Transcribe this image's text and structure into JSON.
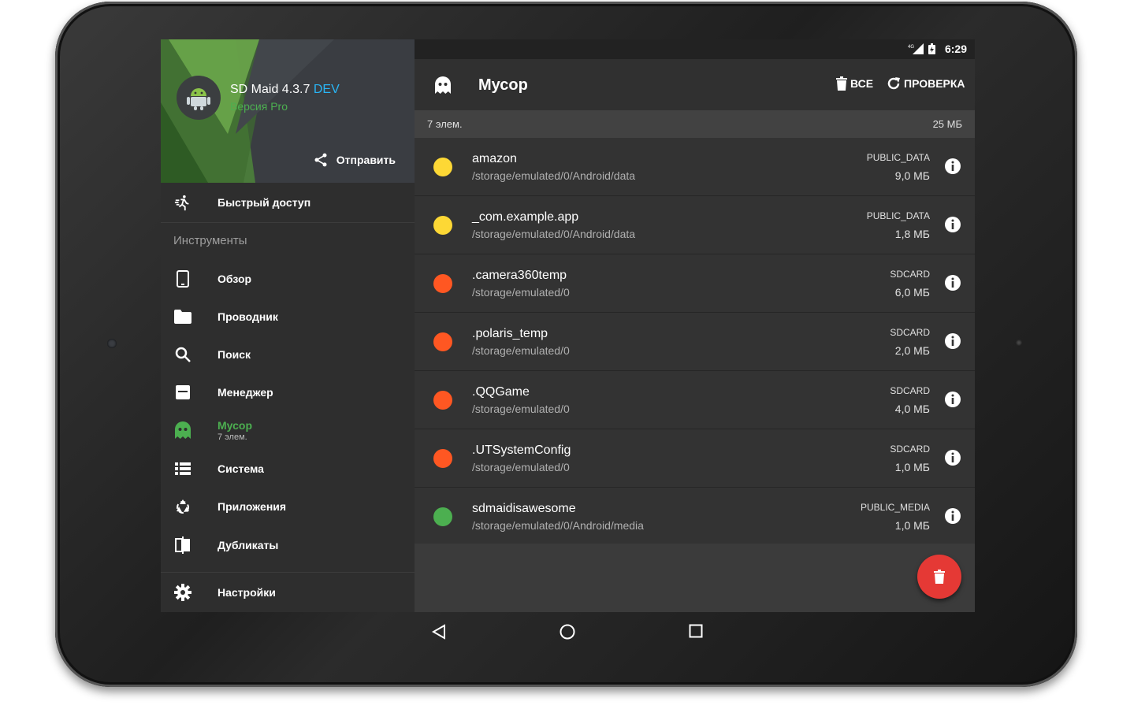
{
  "status": {
    "time": "6:29",
    "network": "4G"
  },
  "drawer": {
    "app_name": "SD Maid 4.3.7",
    "app_tag": "DEV",
    "app_edition": "Версия Pro",
    "share_label": "Отправить",
    "quick_access": "Быстрый доступ",
    "section_tools": "Инструменты",
    "items": [
      {
        "label": "Обзор",
        "icon": "phone-icon"
      },
      {
        "label": "Проводник",
        "icon": "folder-icon"
      },
      {
        "label": "Поиск",
        "icon": "search-icon"
      },
      {
        "label": "Менеджер",
        "icon": "app-manager-icon"
      },
      {
        "label": "Мусор",
        "sub": "7 элем.",
        "icon": "ghost-icon",
        "active": true
      },
      {
        "label": "Система",
        "icon": "list-icon"
      },
      {
        "label": "Приложения",
        "icon": "recycle-icon"
      },
      {
        "label": "Дубликаты",
        "icon": "duplicates-icon"
      }
    ],
    "settings": "Настройки"
  },
  "toolbar": {
    "title": "Мусор",
    "all_label": "ВСЕ",
    "check_label": "ПРОВЕРКА"
  },
  "summary": {
    "count": "7 элем.",
    "size": "25 МБ"
  },
  "entries": [
    {
      "name": "amazon",
      "path": "/storage/emulated/0/Android/data",
      "location": "PUBLIC_DATA",
      "size": "9,0 МБ",
      "color": "#fdd835"
    },
    {
      "name": "_com.example.app",
      "path": "/storage/emulated/0/Android/data",
      "location": "PUBLIC_DATA",
      "size": "1,8 МБ",
      "color": "#fdd835"
    },
    {
      "name": ".camera360temp",
      "path": "/storage/emulated/0",
      "location": "SDCARD",
      "size": "6,0 МБ",
      "color": "#ff5722"
    },
    {
      "name": ".polaris_temp",
      "path": "/storage/emulated/0",
      "location": "SDCARD",
      "size": "2,0 МБ",
      "color": "#ff5722"
    },
    {
      "name": ".QQGame",
      "path": "/storage/emulated/0",
      "location": "SDCARD",
      "size": "4,0 МБ",
      "color": "#ff5722"
    },
    {
      "name": ".UTSystemConfig",
      "path": "/storage/emulated/0",
      "location": "SDCARD",
      "size": "1,0 МБ",
      "color": "#ff5722"
    },
    {
      "name": "sdmaidisawesome",
      "path": "/storage/emulated/0/Android/media",
      "location": "PUBLIC_MEDIA",
      "size": "1,0 МБ",
      "color": "#4caf50"
    }
  ],
  "colors": {
    "accent": "#4caf50",
    "fab": "#e53935",
    "dev": "#29b6f6"
  }
}
